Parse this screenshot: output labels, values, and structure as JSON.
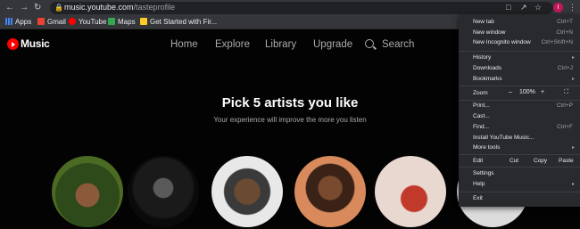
{
  "browser": {
    "url_domain": "music.youtube.com",
    "url_path": "/tasteprofile",
    "profile_initial": "I",
    "bookmarks": [
      "Apps",
      "Gmail",
      "YouTube",
      "Maps",
      "Get Started with Fir..."
    ]
  },
  "app": {
    "brand": "Music",
    "nav": [
      "Home",
      "Explore",
      "Library",
      "Upgrade",
      "Search"
    ]
  },
  "main": {
    "title": "Pick 5 artists you like",
    "subtitle": "Your experience will improve the more you listen"
  },
  "menu": {
    "new_tab": "New tab",
    "new_tab_sc": "Ctrl+T",
    "new_window": "New window",
    "new_window_sc": "Ctrl+N",
    "incognito": "New Incognito window",
    "incognito_sc": "Ctrl+Shift+N",
    "history": "History",
    "downloads": "Downloads",
    "downloads_sc": "Ctrl+J",
    "bookmarks": "Bookmarks",
    "zoom": "Zoom",
    "zoom_minus": "–",
    "zoom_value": "100%",
    "zoom_plus": "+",
    "print": "Print...",
    "print_sc": "Ctrl+P",
    "cast": "Cast...",
    "find": "Find...",
    "find_sc": "Ctrl+F",
    "install": "Install YouTube Music...",
    "more_tools": "More tools",
    "edit": "Edit",
    "cut": "Cut",
    "copy": "Copy",
    "paste": "Paste",
    "settings": "Settings",
    "help": "Help",
    "exit": "Exit"
  },
  "colors": {
    "brand_red": "#ff0000",
    "menu_bg": "#292a2d",
    "page_bg": "#030303"
  }
}
